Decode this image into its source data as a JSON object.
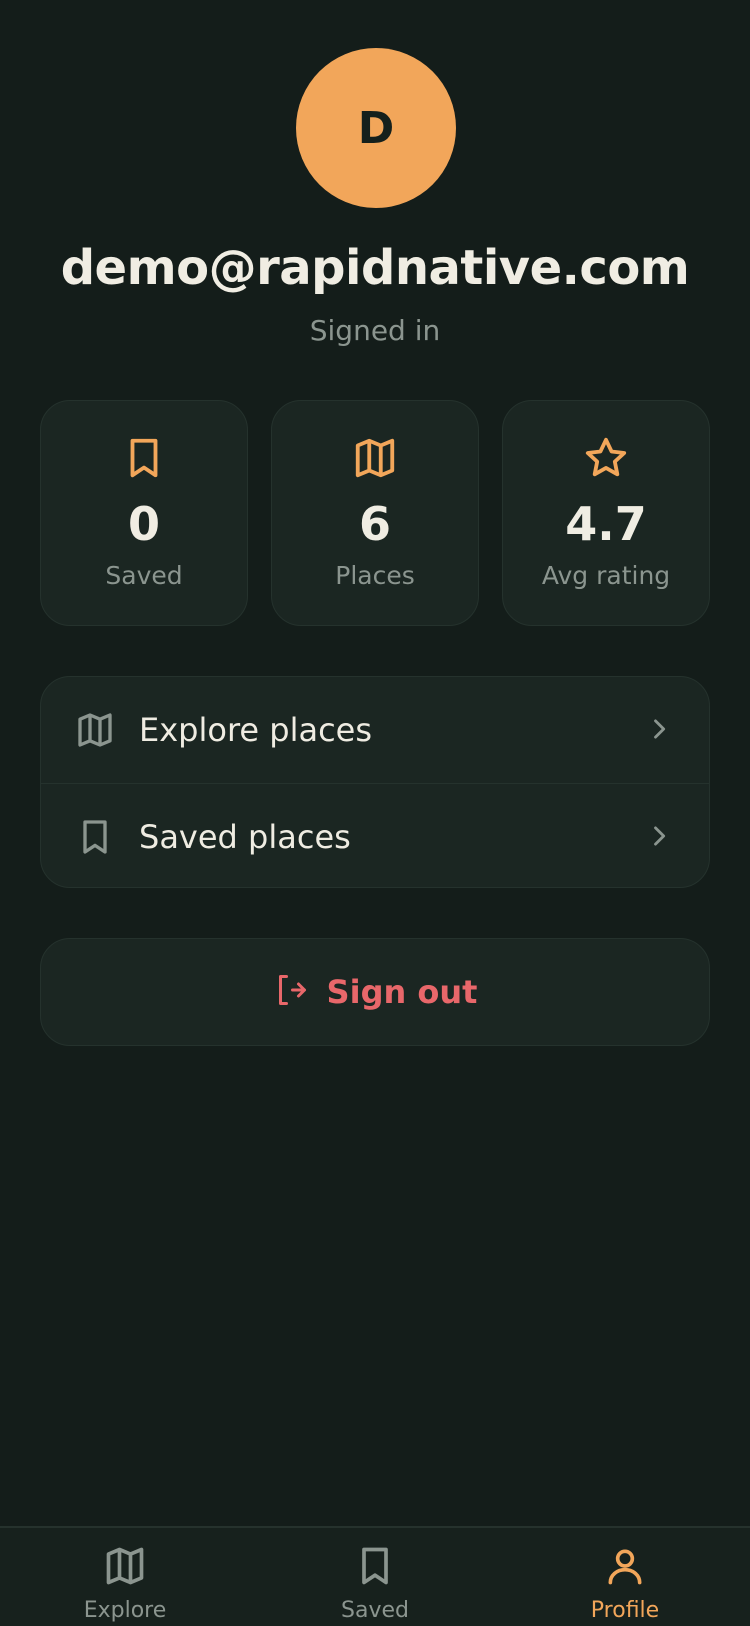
{
  "profile": {
    "avatar_initial": "D",
    "email": "demo@rapidnative.com",
    "status": "Signed in"
  },
  "stats": [
    {
      "icon": "bookmark-icon",
      "value": "0",
      "label": "Saved"
    },
    {
      "icon": "map-icon",
      "value": "6",
      "label": "Places"
    },
    {
      "icon": "star-icon",
      "value": "4.7",
      "label": "Avg rating"
    }
  ],
  "menu": [
    {
      "icon": "map-icon",
      "label": "Explore places"
    },
    {
      "icon": "bookmark-icon",
      "label": "Saved places"
    }
  ],
  "signout": {
    "icon": "logout-icon",
    "label": "Sign out"
  },
  "tabs": [
    {
      "icon": "map-icon",
      "label": "Explore",
      "active": false
    },
    {
      "icon": "bookmark-icon",
      "label": "Saved",
      "active": false
    },
    {
      "icon": "user-icon",
      "label": "Profile",
      "active": true
    }
  ],
  "colors": {
    "background": "#141d1a",
    "card": "#1b2622",
    "accent": "#f2a65a",
    "danger": "#e8676a",
    "muted": "#8b958f",
    "text": "#efece2"
  }
}
